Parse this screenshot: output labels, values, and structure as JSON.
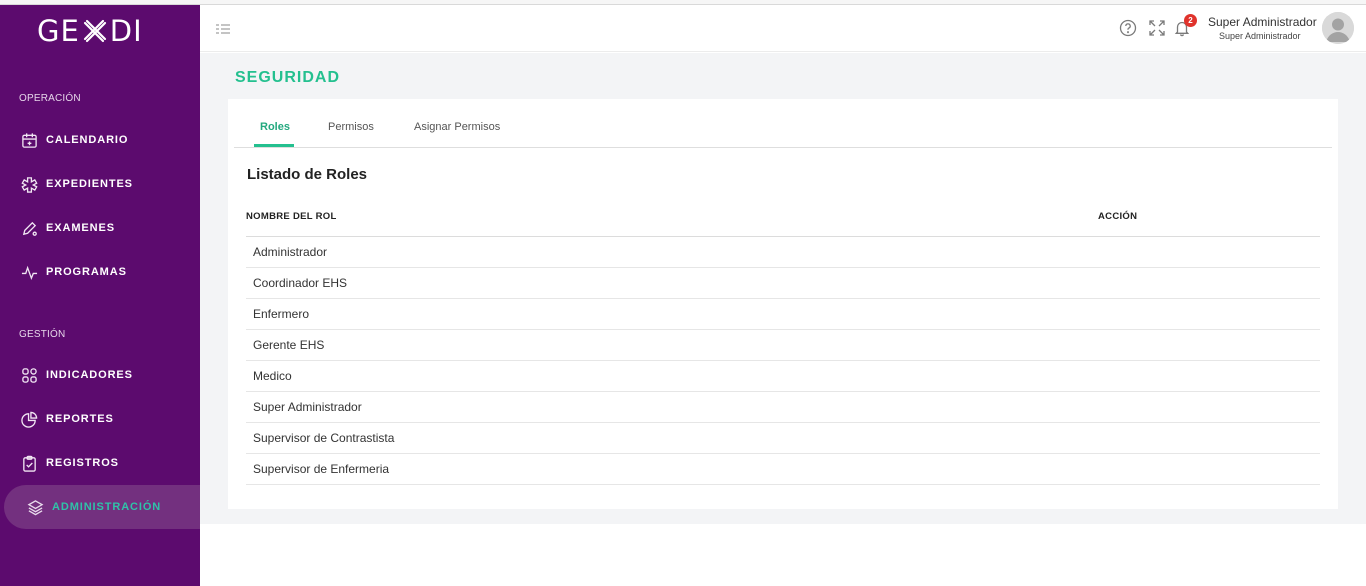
{
  "brand": {
    "logo_left": "GE",
    "logo_right": "DI"
  },
  "sidebar": {
    "sections": [
      {
        "label": "OPERACIÓN"
      },
      {
        "label": "GESTIÓN"
      }
    ],
    "items": [
      {
        "label": "CALENDARIO",
        "icon": "calendar-icon"
      },
      {
        "label": "EXPEDIENTES",
        "icon": "medical-cross-icon"
      },
      {
        "label": "EXAMENES",
        "icon": "pen-icon"
      },
      {
        "label": "PROGRAMAS",
        "icon": "activity-icon"
      },
      {
        "label": "INDICADORES",
        "icon": "grid-icon"
      },
      {
        "label": "REPORTES",
        "icon": "pie-chart-icon"
      },
      {
        "label": "REGISTROS",
        "icon": "clipboard-icon"
      },
      {
        "label": "ADMINISTRACIÓN",
        "icon": "layers-icon",
        "active": true
      }
    ]
  },
  "header": {
    "notification_count": "2",
    "user_name": "Super Administrador",
    "user_role": "Super Administrador"
  },
  "page": {
    "title": "SEGURIDAD"
  },
  "tabs": [
    {
      "label": "Roles",
      "active": true
    },
    {
      "label": "Permisos"
    },
    {
      "label": "Asignar Permisos"
    }
  ],
  "roles": {
    "title": "Listado de Roles",
    "columns": [
      "NOMBRE DEL ROL",
      "ACCIÓN"
    ],
    "rows": [
      "Administrador",
      "Coordinador EHS",
      "Enfermero",
      "Gerente EHS",
      "Medico",
      "Super Administrador",
      "Supervisor de Contrastista",
      "Supervisor de Enfermeria"
    ]
  },
  "colors": {
    "sidebar_bg": "#5c0b6e",
    "accent_green": "#24c08f",
    "badge_red": "#e0332c"
  }
}
